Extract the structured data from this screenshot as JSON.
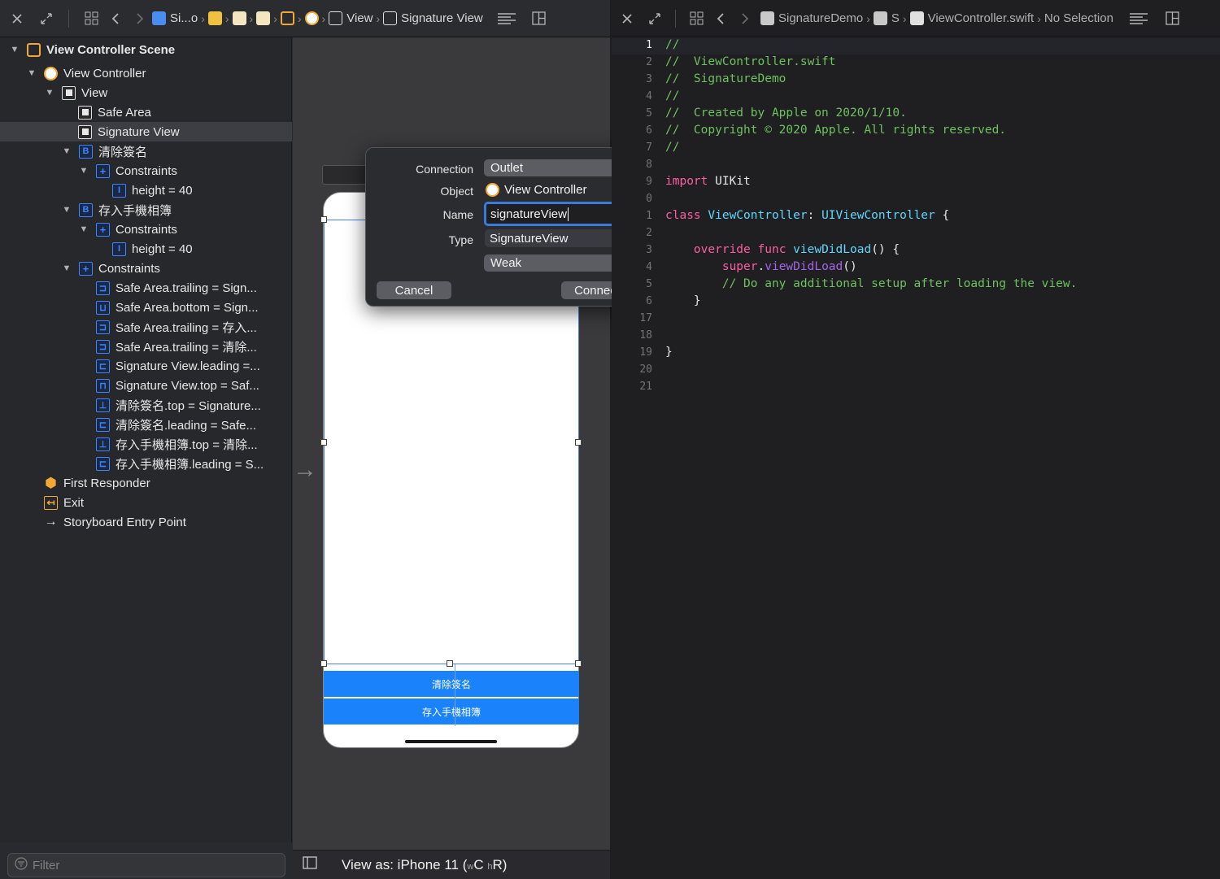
{
  "left_jumpbar": {
    "crumbs": [
      "Si...o",
      "View",
      "Signature View"
    ]
  },
  "right_jumpbar": {
    "crumbs": [
      "SignatureDemo",
      "S",
      "ViewController.swift",
      "No Selection"
    ]
  },
  "outline": {
    "items": [
      {
        "label": "View Controller Scene",
        "bold": true
      },
      {
        "label": "View Controller"
      },
      {
        "label": "View"
      },
      {
        "label": "Safe Area"
      },
      {
        "label": "Signature View",
        "selected": true
      },
      {
        "label": "清除簽名"
      },
      {
        "label": "Constraints"
      },
      {
        "label": "height = 40"
      },
      {
        "label": "存入手機相簿"
      },
      {
        "label": "Constraints"
      },
      {
        "label": "height = 40"
      },
      {
        "label": "Constraints"
      },
      {
        "label": "Safe Area.trailing = Sign..."
      },
      {
        "label": "Safe Area.bottom = Sign..."
      },
      {
        "label": "Safe Area.trailing = 存入..."
      },
      {
        "label": "Safe Area.trailing = 清除..."
      },
      {
        "label": "Signature View.leading =..."
      },
      {
        "label": "Signature View.top = Saf..."
      },
      {
        "label": "清除簽名.top = Signature..."
      },
      {
        "label": "清除簽名.leading = Safe..."
      },
      {
        "label": "存入手機相簿.top = 清除..."
      },
      {
        "label": "存入手機相簿.leading = S..."
      },
      {
        "label": "First Responder"
      },
      {
        "label": "Exit"
      },
      {
        "label": "Storyboard Entry Point"
      }
    ],
    "filter_placeholder": "Filter"
  },
  "canvas": {
    "button_clear": "清除簽名",
    "button_save": "存入手機相簿",
    "view_as": "View as: iPhone 11 (",
    "size_w": "w",
    "size_c": "C",
    "size_h": "h",
    "size_r": "R)"
  },
  "popover": {
    "connection_label": "Connection",
    "connection_value": "Outlet",
    "object_label": "Object",
    "object_value": "View Controller",
    "name_label": "Name",
    "name_value": "signatureView",
    "type_label": "Type",
    "type_value": "SignatureView",
    "storage_value": "Weak",
    "cancel": "Cancel",
    "connect": "Connect"
  },
  "editor": {
    "line_numbers": [
      "1",
      "2",
      "3",
      "4",
      "5",
      "6",
      "7",
      "8",
      "9",
      "0",
      "1",
      "2",
      "3",
      "4",
      "5",
      "6",
      "17",
      "18",
      "19",
      "20",
      "21"
    ],
    "lines": [
      "//",
      "//  ViewController.swift",
      "//  SignatureDemo",
      "//",
      "//  Created by Apple on 2020/1/10.",
      "//  Copyright © 2020 Apple. All rights reserved.",
      "//",
      "",
      "import UIKit",
      "",
      "class ViewController: UIViewController {",
      "",
      "    override func viewDidLoad() {",
      "        super.viewDidLoad()",
      "        // Do any additional setup after loading the view.",
      "    }",
      "",
      "",
      "}",
      "",
      ""
    ],
    "tokens": {
      "import_kw": "import",
      "import_mod": "UIKit",
      "class_kw": "class",
      "class_name": "ViewController",
      "class_colon": ":",
      "super_type": "UIViewController",
      "class_brace": "{",
      "override_kw": "override",
      "func_kw": "func",
      "fn_name": "viewDidLoad",
      "fn_tail": "() {",
      "super_kw": "super",
      "dot": ".",
      "call_name": "viewDidLoad",
      "call_tail": "()",
      "comment_body": "// Do any additional setup after loading the view.",
      "close_inner": "}",
      "close_outer": "}"
    }
  },
  "colors": {
    "accent_blue": "#3a7ad8",
    "ui_button_blue": "#1a82fb",
    "comment_green": "#6ec15f",
    "keyword_pink": "#fc5fa3",
    "type_cyan": "#5dd8ff",
    "storyboard_orange": "#f1a836"
  }
}
